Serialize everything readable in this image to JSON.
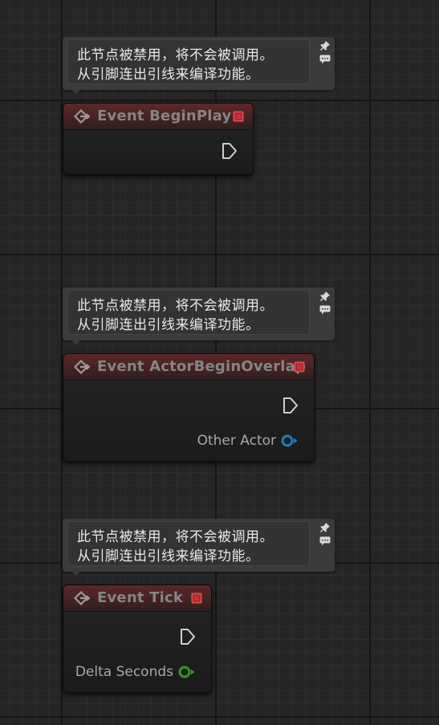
{
  "disabled_comment": {
    "line1": "此节点被禁用，将不会被调用。",
    "line2": "从引脚连出引线来编译功能。"
  },
  "nodes": [
    {
      "title": "Event BeginPlay",
      "outputs": []
    },
    {
      "title": "Event ActorBeginOverlap",
      "outputs": [
        {
          "label": "Other Actor",
          "pin_color": "#1a7fbf",
          "pin_type": "object"
        }
      ]
    },
    {
      "title": "Event Tick",
      "outputs": [
        {
          "label": "Delta Seconds",
          "pin_color": "#2d9c1f",
          "pin_type": "float"
        }
      ]
    }
  ],
  "colors": {
    "header_red": "#5c2727",
    "stop_icon": "#c8343b",
    "exec_pin": "#cfcfcf",
    "comment_bg": "#3b3b3b",
    "grid_bg": "#262626"
  },
  "icons": {
    "comment_pin": "pin-icon",
    "comment_collapse": "chat-bubble-icon",
    "node_type": "event-diamond-icon",
    "node_delegate": "stop-square-icon",
    "exec_out": "exec-arrow-icon"
  }
}
